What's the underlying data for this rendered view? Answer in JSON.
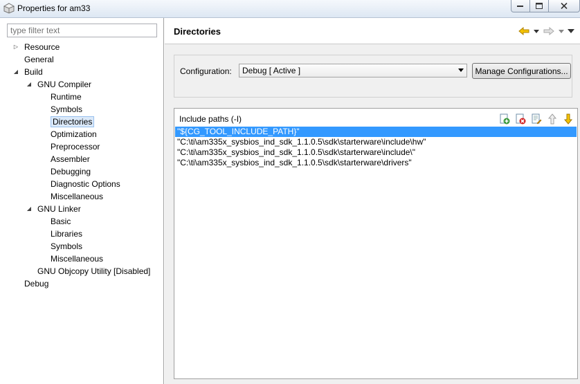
{
  "window": {
    "title": "Properties for am33"
  },
  "filter": {
    "placeholder": "type filter text"
  },
  "tree": [
    {
      "label": "Resource",
      "level": 0,
      "toggle": "collapsed"
    },
    {
      "label": "General",
      "level": 0,
      "toggle": "none"
    },
    {
      "label": "Build",
      "level": 0,
      "toggle": "expanded"
    },
    {
      "label": "GNU Compiler",
      "level": 1,
      "toggle": "expanded"
    },
    {
      "label": "Runtime",
      "level": 2,
      "toggle": "none"
    },
    {
      "label": "Symbols",
      "level": 2,
      "toggle": "none"
    },
    {
      "label": "Directories",
      "level": 2,
      "toggle": "none",
      "selected": true
    },
    {
      "label": "Optimization",
      "level": 2,
      "toggle": "none"
    },
    {
      "label": "Preprocessor",
      "level": 2,
      "toggle": "none"
    },
    {
      "label": "Assembler",
      "level": 2,
      "toggle": "none"
    },
    {
      "label": "Debugging",
      "level": 2,
      "toggle": "none"
    },
    {
      "label": "Diagnostic Options",
      "level": 2,
      "toggle": "none"
    },
    {
      "label": "Miscellaneous",
      "level": 2,
      "toggle": "none"
    },
    {
      "label": "GNU Linker",
      "level": 1,
      "toggle": "expanded"
    },
    {
      "label": "Basic",
      "level": 2,
      "toggle": "none"
    },
    {
      "label": "Libraries",
      "level": 2,
      "toggle": "none"
    },
    {
      "label": "Symbols",
      "level": 2,
      "toggle": "none"
    },
    {
      "label": "Miscellaneous",
      "level": 2,
      "toggle": "none"
    },
    {
      "label": "GNU Objcopy Utility  [Disabled]",
      "level": 1,
      "toggle": "none"
    },
    {
      "label": "Debug",
      "level": 0,
      "toggle": "none"
    }
  ],
  "page": {
    "title": "Directories"
  },
  "config": {
    "label": "Configuration:",
    "selected": "Debug  [ Active ]",
    "manage_label": "Manage Configurations..."
  },
  "include_paths": {
    "title": "Include paths (-I)",
    "items": [
      "\"${CG_TOOL_INCLUDE_PATH}\"",
      "\"C:\\ti\\am335x_sysbios_ind_sdk_1.1.0.5\\sdk\\starterware\\include\\hw\"",
      "\"C:\\ti\\am335x_sysbios_ind_sdk_1.1.0.5\\sdk\\starterware\\include\\\"",
      "\"C:\\ti\\am335x_sysbios_ind_sdk_1.1.0.5\\sdk\\starterware\\drivers\""
    ]
  },
  "colors": {
    "selection": "#3399ff",
    "tree_selection": "#dbe9f9",
    "back_arrow": "#e8a800"
  }
}
